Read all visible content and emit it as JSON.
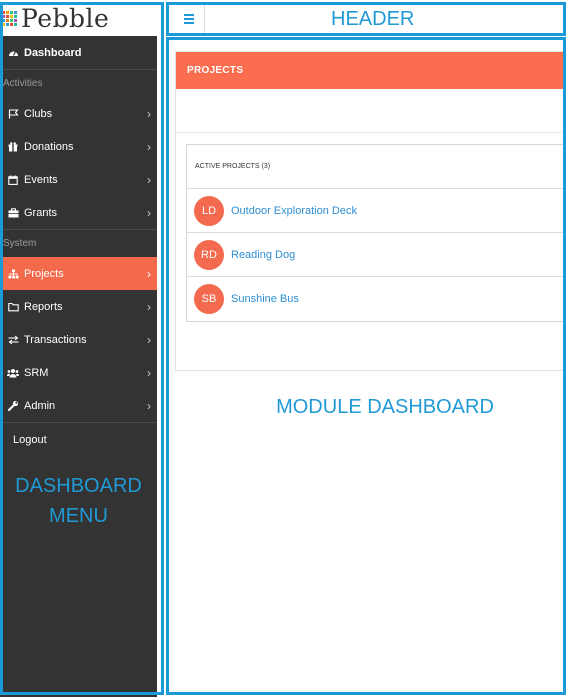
{
  "brand": {
    "name": "Pebble"
  },
  "colors": {
    "accent": "#fa6e4f",
    "link": "#2e8fd4",
    "annotation": "#1a9ad6",
    "sidebar_bg": "#333333"
  },
  "sidebar": {
    "items": [
      {
        "label": "Dashboard",
        "icon": "dashboard-icon",
        "bold": true,
        "chevron": false
      },
      {
        "section": "Activities"
      },
      {
        "label": "Clubs",
        "icon": "flag-icon",
        "chevron": true
      },
      {
        "label": "Donations",
        "icon": "gift-icon",
        "chevron": true
      },
      {
        "label": "Events",
        "icon": "calendar-icon",
        "chevron": true
      },
      {
        "label": "Grants",
        "icon": "briefcase-icon",
        "chevron": true
      },
      {
        "section": "System"
      },
      {
        "label": "Projects",
        "icon": "sitemap-icon",
        "chevron": true,
        "active": true
      },
      {
        "label": "Reports",
        "icon": "folder-icon",
        "chevron": true
      },
      {
        "label": "Transactions",
        "icon": "exchange-icon",
        "chevron": true
      },
      {
        "label": "SRM",
        "icon": "users-icon",
        "chevron": true
      },
      {
        "label": "Admin",
        "icon": "wrench-icon",
        "chevron": true
      }
    ],
    "logout": "Logout"
  },
  "annotations": {
    "header": "HEADER",
    "module": "MODULE DASHBOARD",
    "menu_line1": "DASHBOARD",
    "menu_line2": "MENU"
  },
  "panel": {
    "title": "PROJECTS",
    "card_title": "ACTIVE PROJECTS (3)",
    "projects": [
      {
        "initials": "LD",
        "name": "Outdoor Exploration Deck"
      },
      {
        "initials": "RD",
        "name": "Reading Dog"
      },
      {
        "initials": "SB",
        "name": "Sunshine Bus"
      }
    ]
  }
}
